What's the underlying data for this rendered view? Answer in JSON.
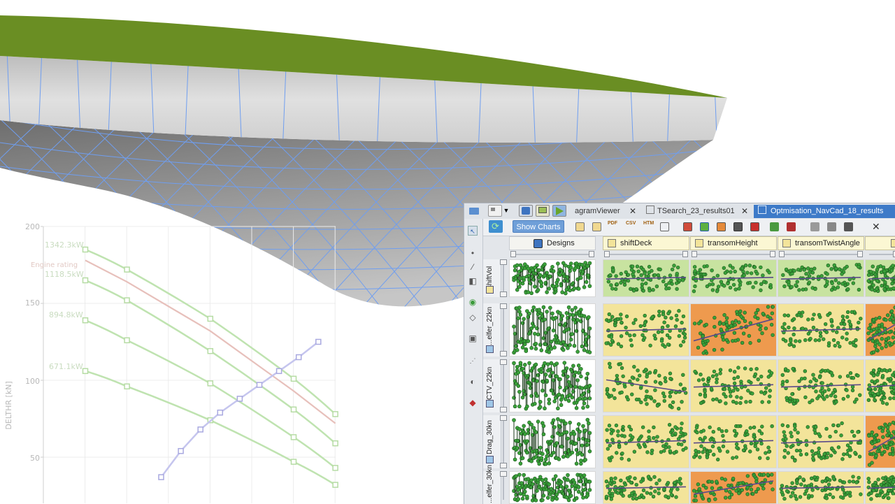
{
  "colors": {
    "deck": "#6a8e23",
    "hull_side": "#d4d4d4",
    "hull_bottom": "#8a8a8a",
    "mesh": "#6f9ef0",
    "tab_active": "#3d7ac8",
    "show_charts": "#6f9fd8",
    "cell_yellow": "#f3e49a",
    "cell_orange": "#ee9a4e",
    "cell_green": "#c8e3a0",
    "point": "#3aa13a"
  },
  "chart": {
    "ylabel": "DELTHR [kN]",
    "yticks": [
      "200",
      "150",
      "100",
      "50"
    ],
    "power_labels": [
      "1342.3kW",
      "1118.5kW",
      "894.8kW",
      "671.1kW"
    ],
    "engine_rating_label": "Engine rating"
  },
  "chart_data": {
    "type": "line",
    "ylabel": "DELTHR [kN]",
    "ylim": [
      25,
      200
    ],
    "x": [
      1,
      2,
      3,
      4,
      5,
      6,
      7
    ],
    "series": [
      {
        "name": "1342.3kW",
        "values": [
          185,
          172,
          null,
          140,
          null,
          101,
          78
        ]
      },
      {
        "name": "1118.5kW",
        "values": [
          165,
          152,
          null,
          119,
          null,
          81,
          59
        ]
      },
      {
        "name": "894.8kW",
        "values": [
          139,
          126,
          null,
          98,
          null,
          63,
          43
        ]
      },
      {
        "name": "671.1kW",
        "values": [
          106,
          96,
          null,
          74,
          null,
          47,
          32
        ]
      },
      {
        "name": "Engine rating",
        "values": [
          178,
          164,
          null,
          132,
          null,
          93,
          72
        ]
      }
    ],
    "demand_curve": [
      [
        31,
        37
      ],
      [
        33,
        54
      ],
      [
        35,
        68
      ],
      [
        37,
        79
      ],
      [
        39,
        88
      ],
      [
        41,
        97
      ],
      [
        43,
        106
      ],
      [
        45,
        115
      ],
      [
        47,
        125
      ]
    ]
  },
  "tabs": [
    {
      "label": "agramViewer",
      "active": false
    },
    {
      "label": "TSearch_23_results01",
      "active": false
    },
    {
      "label": "Optmisation_NavCad_18_results",
      "active": true
    }
  ],
  "toolbar": {
    "show_charts": "Show Charts",
    "pdf": "PDF",
    "csv": "CSV",
    "htm": "HTM"
  },
  "columns": [
    "Designs",
    "shiftDeck",
    "transomHeight",
    "transomTwistAngle"
  ],
  "rows": [
    {
      "label": "shiftVol"
    },
    {
      "label": "...elfer_22kn"
    },
    {
      "label": "CTV_22kn"
    },
    {
      "label": "Drag_30kn"
    },
    {
      "label": "...elfer_30kn"
    }
  ],
  "cell_colors": [
    [
      "green",
      "green",
      "green",
      "green"
    ],
    [
      "yellow",
      "orange",
      "yellow",
      "orange"
    ],
    [
      "yellow",
      "yellow",
      "yellow",
      "yellow"
    ],
    [
      "yellow",
      "yellow",
      "yellow",
      "orange"
    ],
    [
      "yellow",
      "orange",
      "yellow",
      "yellow"
    ]
  ]
}
